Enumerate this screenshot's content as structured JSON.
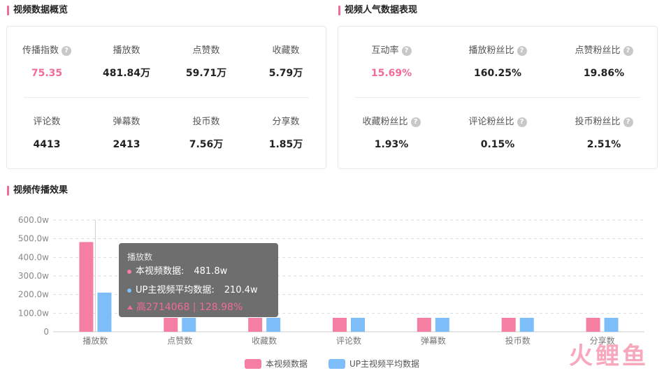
{
  "overview": {
    "title": "视频数据概览",
    "row1": [
      {
        "label": "传播指数",
        "value": "75.35",
        "help": true,
        "accent": true
      },
      {
        "label": "播放数",
        "value": "481.84万",
        "help": false,
        "accent": false
      },
      {
        "label": "点赞数",
        "value": "59.71万",
        "help": false,
        "accent": false
      },
      {
        "label": "收藏数",
        "value": "5.79万",
        "help": false,
        "accent": false
      }
    ],
    "row2": [
      {
        "label": "评论数",
        "value": "4413",
        "help": false,
        "accent": false
      },
      {
        "label": "弹幕数",
        "value": "2413",
        "help": false,
        "accent": false
      },
      {
        "label": "投币数",
        "value": "7.56万",
        "help": false,
        "accent": false
      },
      {
        "label": "分享数",
        "value": "1.85万",
        "help": false,
        "accent": false
      }
    ]
  },
  "popularity": {
    "title": "视频人气数据表现",
    "row1": [
      {
        "label": "互动率",
        "value": "15.69%",
        "help": true,
        "accent": true
      },
      {
        "label": "播放粉丝比",
        "value": "160.25%",
        "help": true,
        "accent": false
      },
      {
        "label": "点赞粉丝比",
        "value": "19.86%",
        "help": true,
        "accent": false
      }
    ],
    "row2": [
      {
        "label": "收藏粉丝比",
        "value": "1.93%",
        "help": true,
        "accent": false
      },
      {
        "label": "评论粉丝比",
        "value": "0.15%",
        "help": true,
        "accent": false
      },
      {
        "label": "投币粉丝比",
        "value": "2.51%",
        "help": true,
        "accent": false
      }
    ]
  },
  "spread": {
    "title": "视频传播效果"
  },
  "help_glyph": "?",
  "chart_data": {
    "type": "bar",
    "categories": [
      "播放数",
      "点赞数",
      "收藏数",
      "评论数",
      "弹幕数",
      "投币数",
      "分享数"
    ],
    "series": [
      {
        "name": "本视频数据",
        "color": "#f57ea3",
        "values": [
          481.8,
          59.7,
          5.8,
          0.4,
          0.2,
          7.6,
          1.9
        ]
      },
      {
        "name": "UP主视频平均数据",
        "color": "#7dbdf9",
        "values": [
          210.4,
          45,
          6,
          1,
          0.5,
          9,
          2.5
        ]
      }
    ],
    "ylim": [
      0,
      600
    ],
    "yticks": [
      "0",
      "100.0w",
      "200.0w",
      "300.0w",
      "400.0w",
      "500.0w",
      "600.0w"
    ],
    "ytick_values": [
      0,
      100,
      200,
      300,
      400,
      500,
      600
    ],
    "min_visible_value": 75,
    "grid": true,
    "legend": "bottom-center"
  },
  "tooltip": {
    "title": "播放数",
    "line1_label": "本视频数据:",
    "line1_value": "481.8w",
    "line2_label": "UP主视频平均数据:",
    "line2_value": "210.4w",
    "diff": "高2714068 | 128.98%"
  },
  "watermark": "火鲤鱼",
  "colors": {
    "accent": "#f06c96",
    "series1": "#f57ea3",
    "series2": "#7dbdf9"
  }
}
